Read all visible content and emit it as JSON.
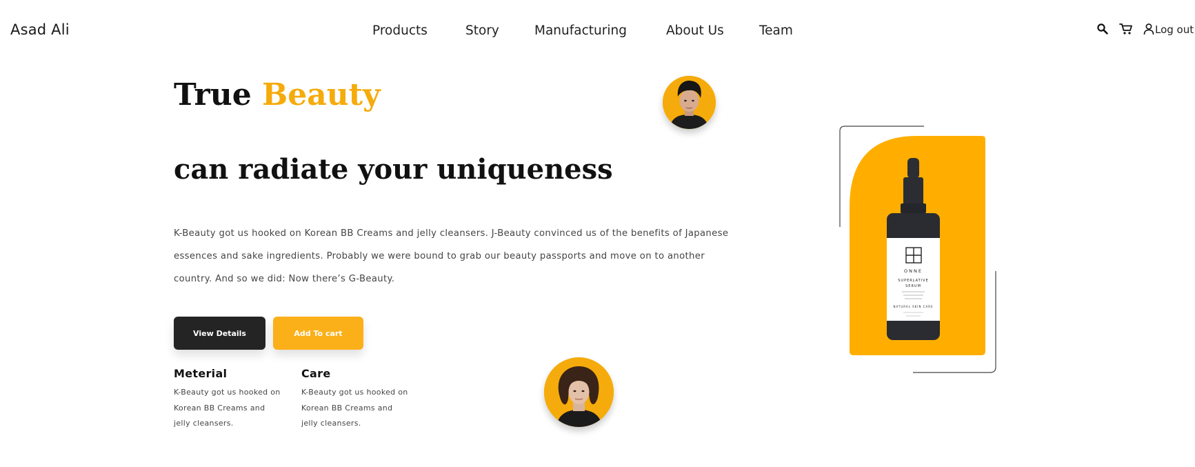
{
  "header": {
    "brand": "Asad Ali",
    "nav": [
      "Products",
      "Story",
      "Manufacturing",
      "About Us",
      "Team"
    ],
    "icons": [
      "search-icon",
      "cart-icon",
      "user-icon"
    ],
    "logout": "Log out"
  },
  "hero": {
    "title_start": "True",
    "title_accent": "Beauty",
    "subtitle": "can radiate your uniqueness",
    "description": "K-Beauty got us hooked on Korean BB Creams and jelly cleansers. J-Beauty convinced us of the benefits of Japanese essences and sake ingredients. Probably we were bound to grab our beauty passports and move on to another country. And so we did: Now there’s G-Beauty.",
    "buttons": {
      "view_details": "View Details",
      "add_to_cart": "Add To cart"
    },
    "features": [
      {
        "title": "Meterial",
        "text": "K-Beauty got us hooked on Korean BB Creams and jelly cleansers."
      },
      {
        "title": "Care",
        "text": "K-Beauty got us hooked on Korean BB Creams and jelly cleansers."
      }
    ]
  },
  "product": {
    "brand": "ONNE",
    "name_line1": "SUPERLATIVE",
    "name_line2": "SERUM",
    "tagline": "NATURAL SKIN CARE"
  },
  "colors": {
    "accent": "#f5ab0b",
    "button_dark": "#242424",
    "button_yellow": "#fbb01a",
    "text": "#1e1e1e"
  }
}
